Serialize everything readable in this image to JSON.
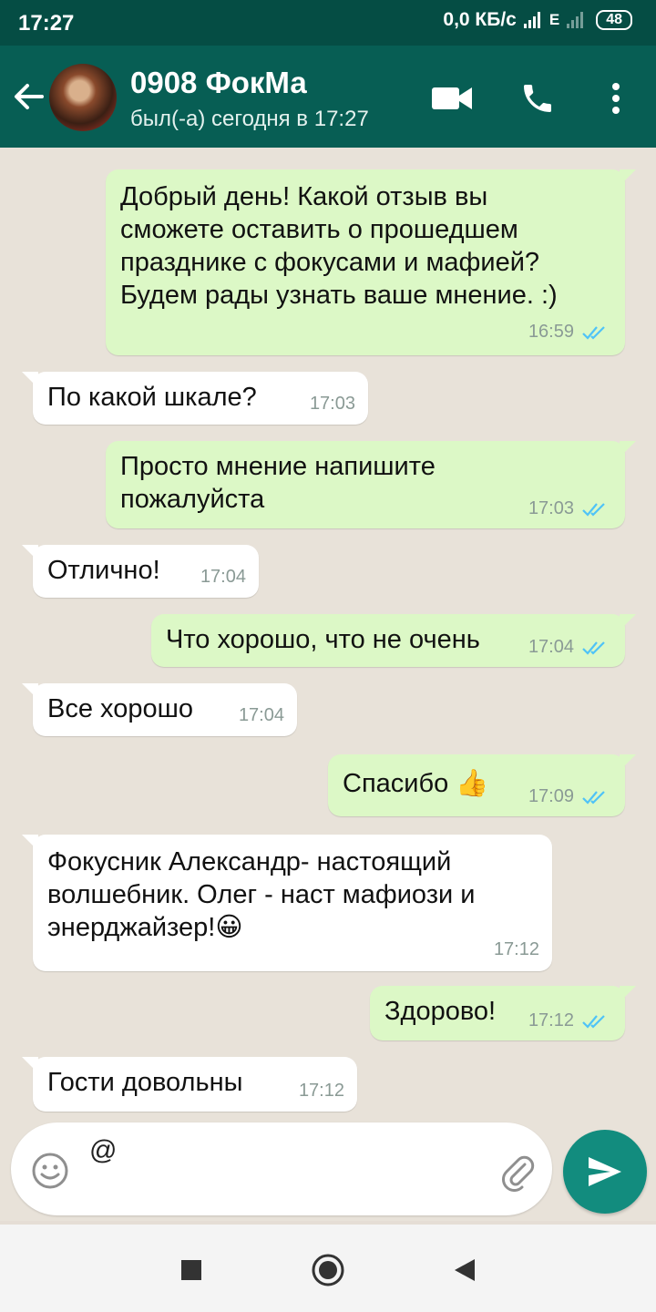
{
  "status_bar": {
    "time": "17:27",
    "network_speed": "0,0 КБ/с",
    "network_type": "E",
    "battery": "48"
  },
  "header": {
    "contact_name": "0908 ФокМа",
    "last_seen": "был(-а) сегодня в 17:27",
    "icons": [
      "arrow-left-icon",
      "videocam-icon",
      "phone-icon",
      "more-vert-icon"
    ]
  },
  "messages": [
    {
      "direction": "out",
      "text": "Добрый день! Какой отзыв вы\nсможете оставить о прошедшем\nпразднике с фокусами и мафией?\nБудем рады узнать ваше мнение. :)",
      "time": "16:59",
      "read": true
    },
    {
      "direction": "in",
      "text": "По какой шкале?",
      "time": "17:03"
    },
    {
      "direction": "out",
      "text": "Просто мнение напишите\nпожалуйста",
      "time": "17:03",
      "read": true
    },
    {
      "direction": "in",
      "text": "Отлично!",
      "time": "17:04"
    },
    {
      "direction": "out",
      "text": "Что хорошо, что не очень",
      "time": "17:04",
      "read": true
    },
    {
      "direction": "in",
      "text": "Все хорошо",
      "time": "17:04"
    },
    {
      "direction": "out",
      "text": "Спасибо 👍",
      "time": "17:09",
      "read": true
    },
    {
      "direction": "in",
      "text": "Фокусник Александр- настоящий\nволшебник. Олег - наст мафиози и\nэнерджайзер!😀",
      "time": "17:12"
    },
    {
      "direction": "out",
      "text": "Здорово!",
      "time": "17:12",
      "read": true
    },
    {
      "direction": "in",
      "text": "Гости довольны",
      "time": "17:12"
    }
  ],
  "composer": {
    "value": "@",
    "icons": [
      "emoji-icon",
      "paperclip-icon",
      "send-icon"
    ]
  },
  "colors": {
    "header": "#075e54",
    "status_bar": "#054d44",
    "outgoing_bubble": "#dcf8c6",
    "incoming_bubble": "#ffffff",
    "read_ticks": "#4fc3f7",
    "send_button": "#128c7e"
  },
  "nav": [
    "recents-square-icon",
    "home-circle-icon",
    "back-triangle-icon"
  ]
}
